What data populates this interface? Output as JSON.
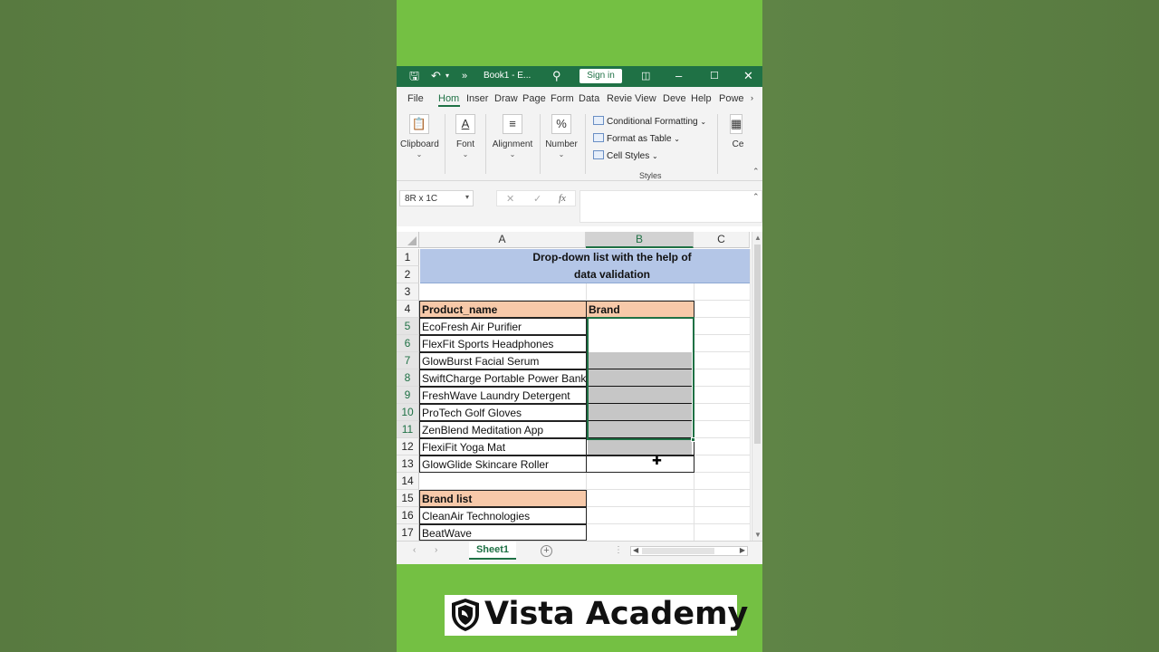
{
  "window": {
    "book_title": "Book1 - E...",
    "sign_in": "Sign in",
    "more_glyph": "»"
  },
  "ribbon": {
    "tabs": [
      "File",
      "Hom",
      "Inser",
      "Draw",
      "Page",
      "Form",
      "Data",
      "Revie",
      "View",
      "Deve",
      "Help",
      "Powe"
    ],
    "active_tab": "Hom",
    "groups": {
      "clipboard": "Clipboard",
      "font": "Font",
      "alignment": "Alignment",
      "number": "Number",
      "cells": "Ce"
    },
    "styles": {
      "conditional_formatting": "Conditional Formatting",
      "format_as_table": "Format as Table",
      "cell_styles": "Cell Styles",
      "label": "Styles"
    }
  },
  "formula_bar": {
    "name_box": "8R x 1C",
    "cancel": "✕",
    "enter": "✓",
    "fx": "fx",
    "value": ""
  },
  "grid": {
    "columns": [
      "A",
      "B",
      "C"
    ],
    "selected_column": "B",
    "rows": [
      "1",
      "2",
      "3",
      "4",
      "5",
      "6",
      "7",
      "8",
      "9",
      "10",
      "11",
      "12",
      "13",
      "14",
      "15",
      "16",
      "17"
    ],
    "title_line1": "Drop-down list with the help of",
    "title_line2": "data validation",
    "header_product": "Product_name",
    "header_brand": "Brand",
    "products": [
      "EcoFresh Air Purifier",
      "FlexFit Sports Headphones",
      "GlowBurst Facial Serum",
      "SwiftCharge Portable Power Bank",
      "FreshWave Laundry Detergent",
      "ProTech Golf Gloves",
      "ZenBlend Meditation App",
      "FlexiFit Yoga Mat",
      "GlowGlide Skincare Roller"
    ],
    "brand_list_header": "Brand list",
    "brands": [
      "CleanAir Technologies",
      "BeatWave"
    ]
  },
  "sheets": {
    "active": "Sheet1",
    "add": "+"
  },
  "brand_overlay": {
    "name": "Vista Academy"
  },
  "colors": {
    "excel_green": "#1f7145",
    "title_fill": "#b4c6e7",
    "header_fill": "#f7c9a9",
    "selection_fill": "#c6c6c6",
    "background_green": "#74c043"
  }
}
